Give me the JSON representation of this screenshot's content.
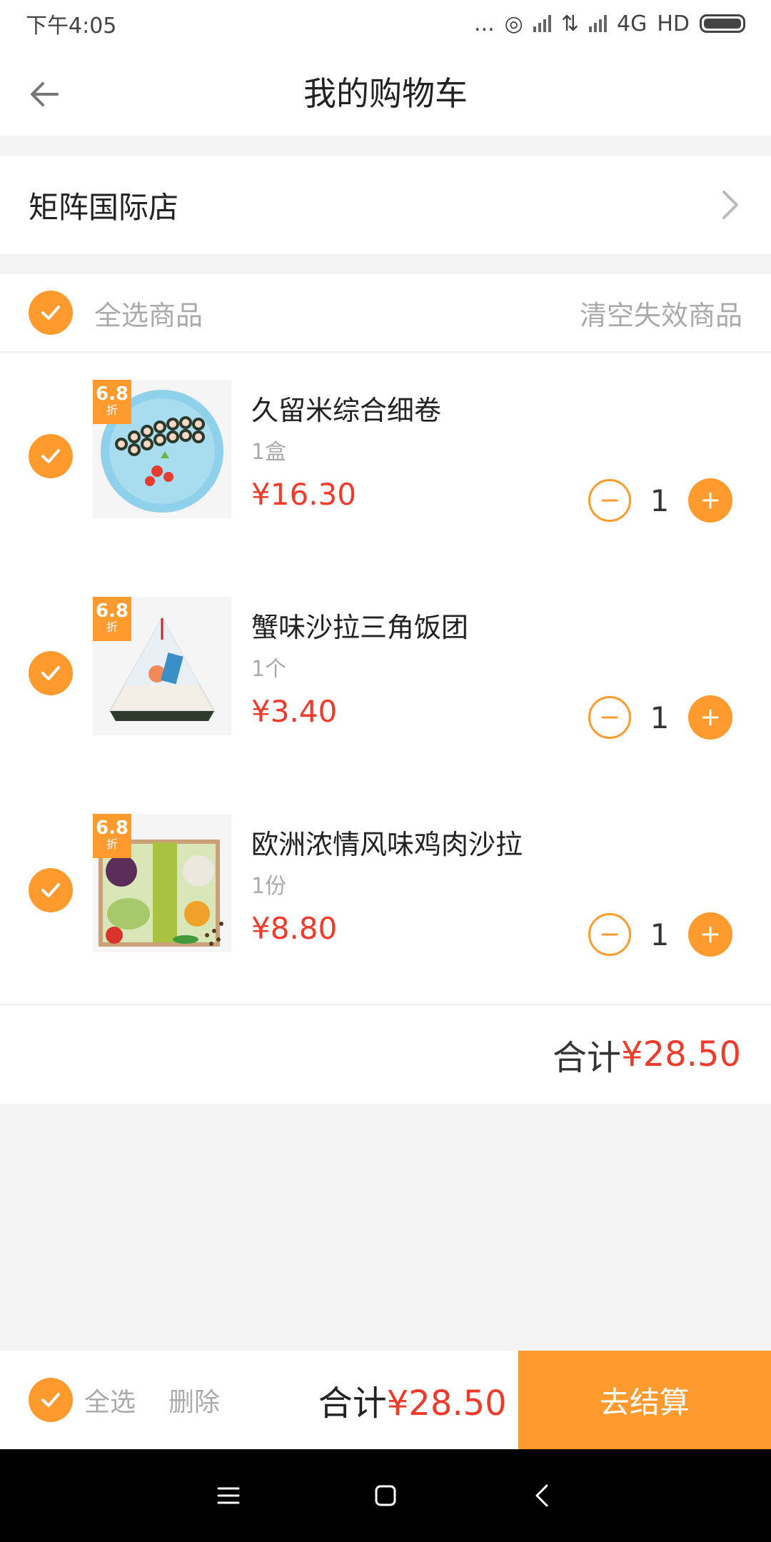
{
  "status_bar": {
    "time": "下午4:05",
    "dots": "...",
    "network": "4G",
    "hd": "HD"
  },
  "header": {
    "title": "我的购物车"
  },
  "store": {
    "name": "矩阵国际店"
  },
  "cart": {
    "select_all_label": "全选商品",
    "clear_invalid_label": "清空失效商品",
    "items": [
      {
        "name": "久留米综合细卷",
        "unit": "1盒",
        "price": "¥16.30",
        "quantity": "1",
        "tag_big": "6.8",
        "tag_small": "折"
      },
      {
        "name": "蟹味沙拉三角饭团",
        "unit": "1个",
        "price": "¥3.40",
        "quantity": "1",
        "tag_big": "6.8",
        "tag_small": "折"
      },
      {
        "name": "欧洲浓情风味鸡肉沙拉",
        "unit": "1份",
        "price": "¥8.80",
        "quantity": "1",
        "tag_big": "6.8",
        "tag_small": "折"
      }
    ],
    "subtotal_label": "合计",
    "subtotal_value": "¥28.50"
  },
  "footer": {
    "select_all": "全选",
    "delete": "删除",
    "total_label": "合计",
    "total_value": "¥28.50",
    "checkout": "去结算"
  },
  "colors": {
    "accent": "#ff9a2e",
    "price": "#f03a2a"
  },
  "icons": [
    "back-arrow-icon",
    "chevron-right-icon",
    "check-icon",
    "minus-icon",
    "plus-icon",
    "menu-icon",
    "home-icon",
    "back-icon"
  ]
}
